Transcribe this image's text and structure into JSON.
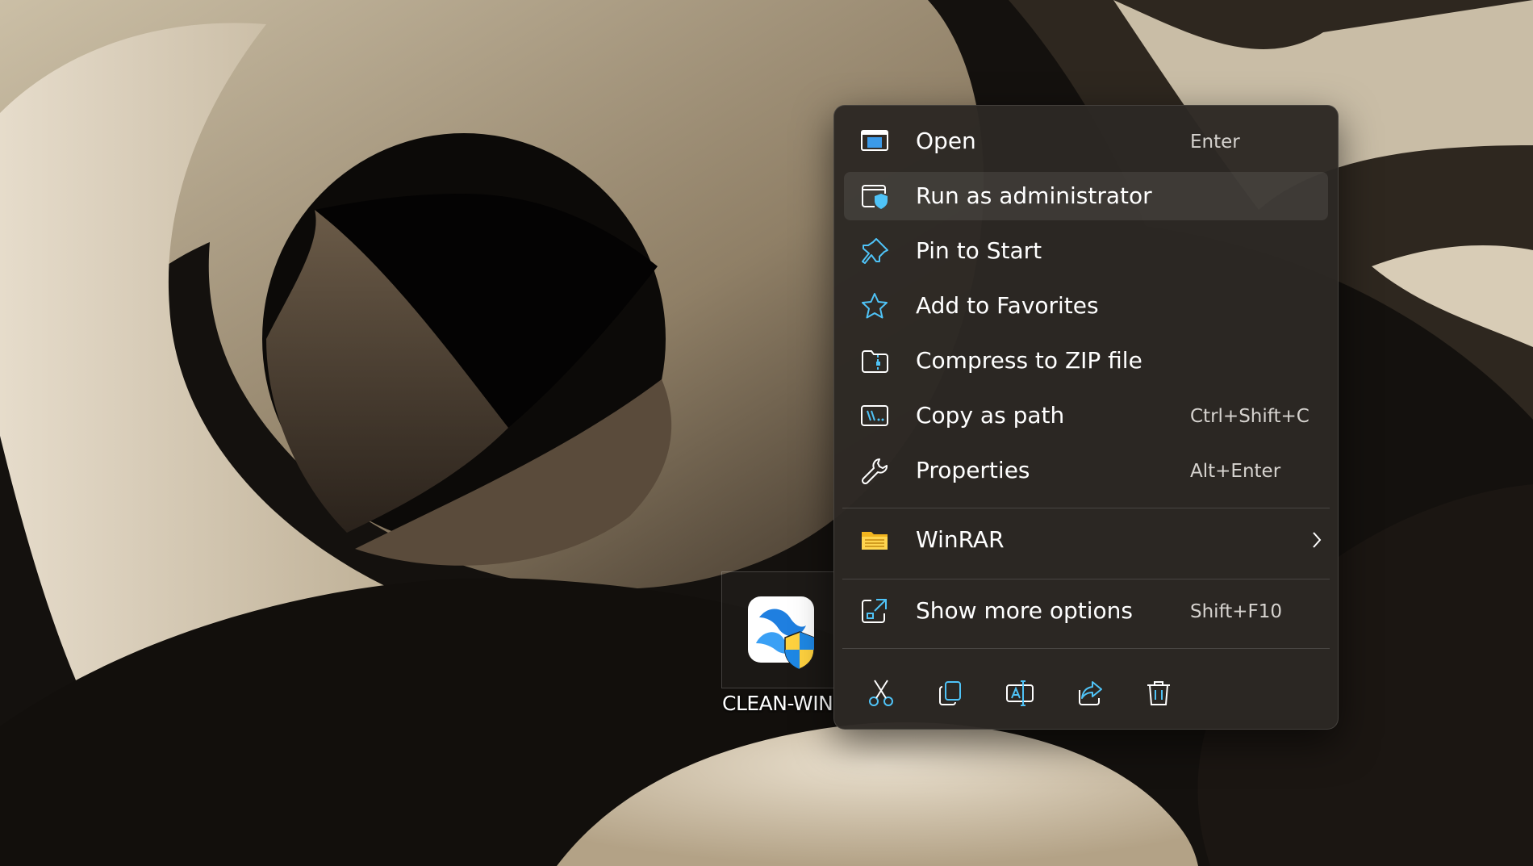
{
  "desktop": {
    "icon_label": "CLEAN-WIN",
    "icon_name": "app-shortcut-with-uac-shield"
  },
  "context_menu": {
    "items": [
      {
        "id": "open",
        "label": "Open",
        "shortcut": "Enter",
        "icon": "open-window-icon"
      },
      {
        "id": "run-as-admin",
        "label": "Run as administrator",
        "shortcut": "",
        "icon": "admin-shield-icon",
        "highlighted": true
      },
      {
        "id": "pin-to-start",
        "label": "Pin to Start",
        "shortcut": "",
        "icon": "pin-icon"
      },
      {
        "id": "add-to-favorites",
        "label": "Add to Favorites",
        "shortcut": "",
        "icon": "star-icon"
      },
      {
        "id": "compress-zip",
        "label": "Compress to ZIP file",
        "shortcut": "",
        "icon": "zip-folder-icon"
      },
      {
        "id": "copy-as-path",
        "label": "Copy as path",
        "shortcut": "Ctrl+Shift+C",
        "icon": "copy-path-icon"
      },
      {
        "id": "properties",
        "label": "Properties",
        "shortcut": "Alt+Enter",
        "icon": "wrench-icon"
      }
    ],
    "submenu": {
      "label": "WinRAR",
      "icon": "winrar-folder-icon",
      "has_submenu": true
    },
    "more": {
      "label": "Show more options",
      "shortcut": "Shift+F10",
      "icon": "expand-icon"
    },
    "action_bar": [
      {
        "id": "cut",
        "icon": "scissors-icon"
      },
      {
        "id": "copy",
        "icon": "copy-icon"
      },
      {
        "id": "rename",
        "icon": "rename-icon"
      },
      {
        "id": "share",
        "icon": "share-icon"
      },
      {
        "id": "delete",
        "icon": "trash-icon"
      }
    ]
  },
  "colors": {
    "menu_bg": "#2c2824",
    "accent": "#4fc3f7",
    "text": "#ffffff",
    "shortcut_text": "#d6d3cf"
  }
}
